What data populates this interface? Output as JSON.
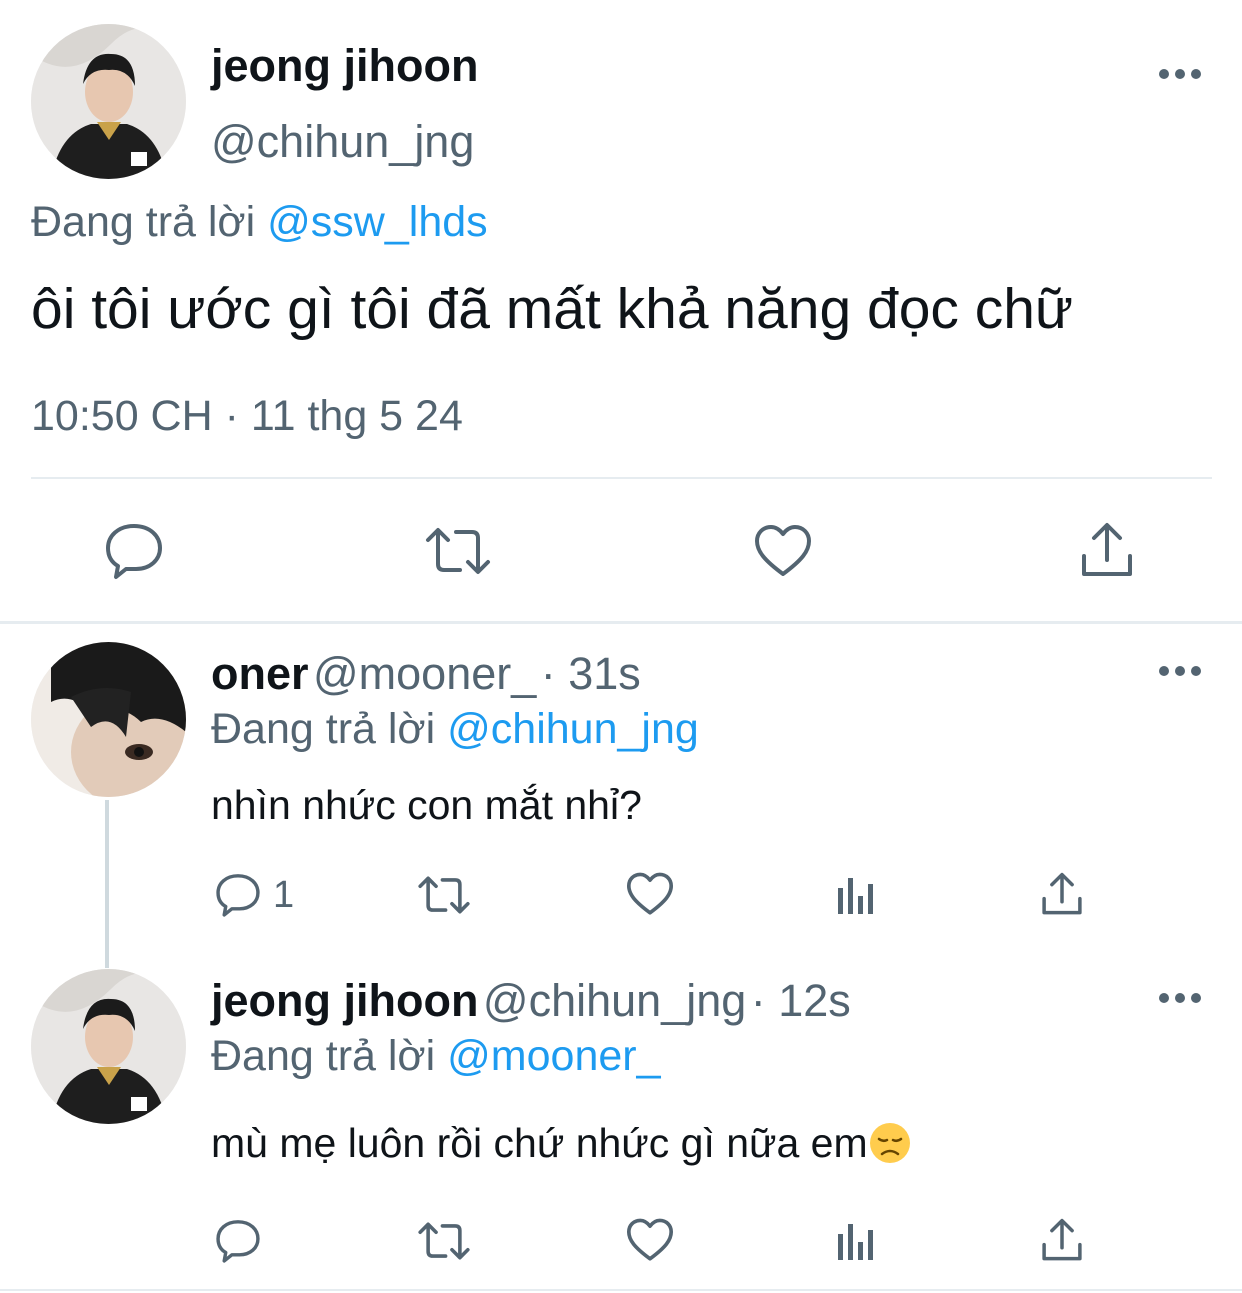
{
  "main_tweet": {
    "display_name": "jeong jihoon",
    "handle": "@chihun_jng",
    "replying_prefix": "Đang trả lời",
    "replying_to": "@ssw_lhds",
    "text": "ôi tôi ước gì tôi đã mất khả năng đọc chữ",
    "timestamp": "10:50 CH · 11 thg 5 24"
  },
  "reply_1": {
    "display_name": "oner",
    "handle": "@mooner_",
    "time": "· 31s",
    "replying_prefix": "Đang trả lời",
    "replying_to": "@chihun_jng",
    "text": "nhìn nhức con mắt nhỉ?",
    "reply_count": "1"
  },
  "reply_2": {
    "display_name": "jeong jihoon",
    "handle": "@chihun_jng",
    "time": "· 12s",
    "replying_prefix": "Đang trả lời",
    "replying_to": "@mooner_",
    "text": "mù mẹ luôn rồi chứ nhức gì nữa em",
    "emoji_icon": "disappointed-face"
  },
  "colors": {
    "accent": "#1d9bf0",
    "secondary_text": "#536471",
    "divider": "#e6ecf0"
  }
}
